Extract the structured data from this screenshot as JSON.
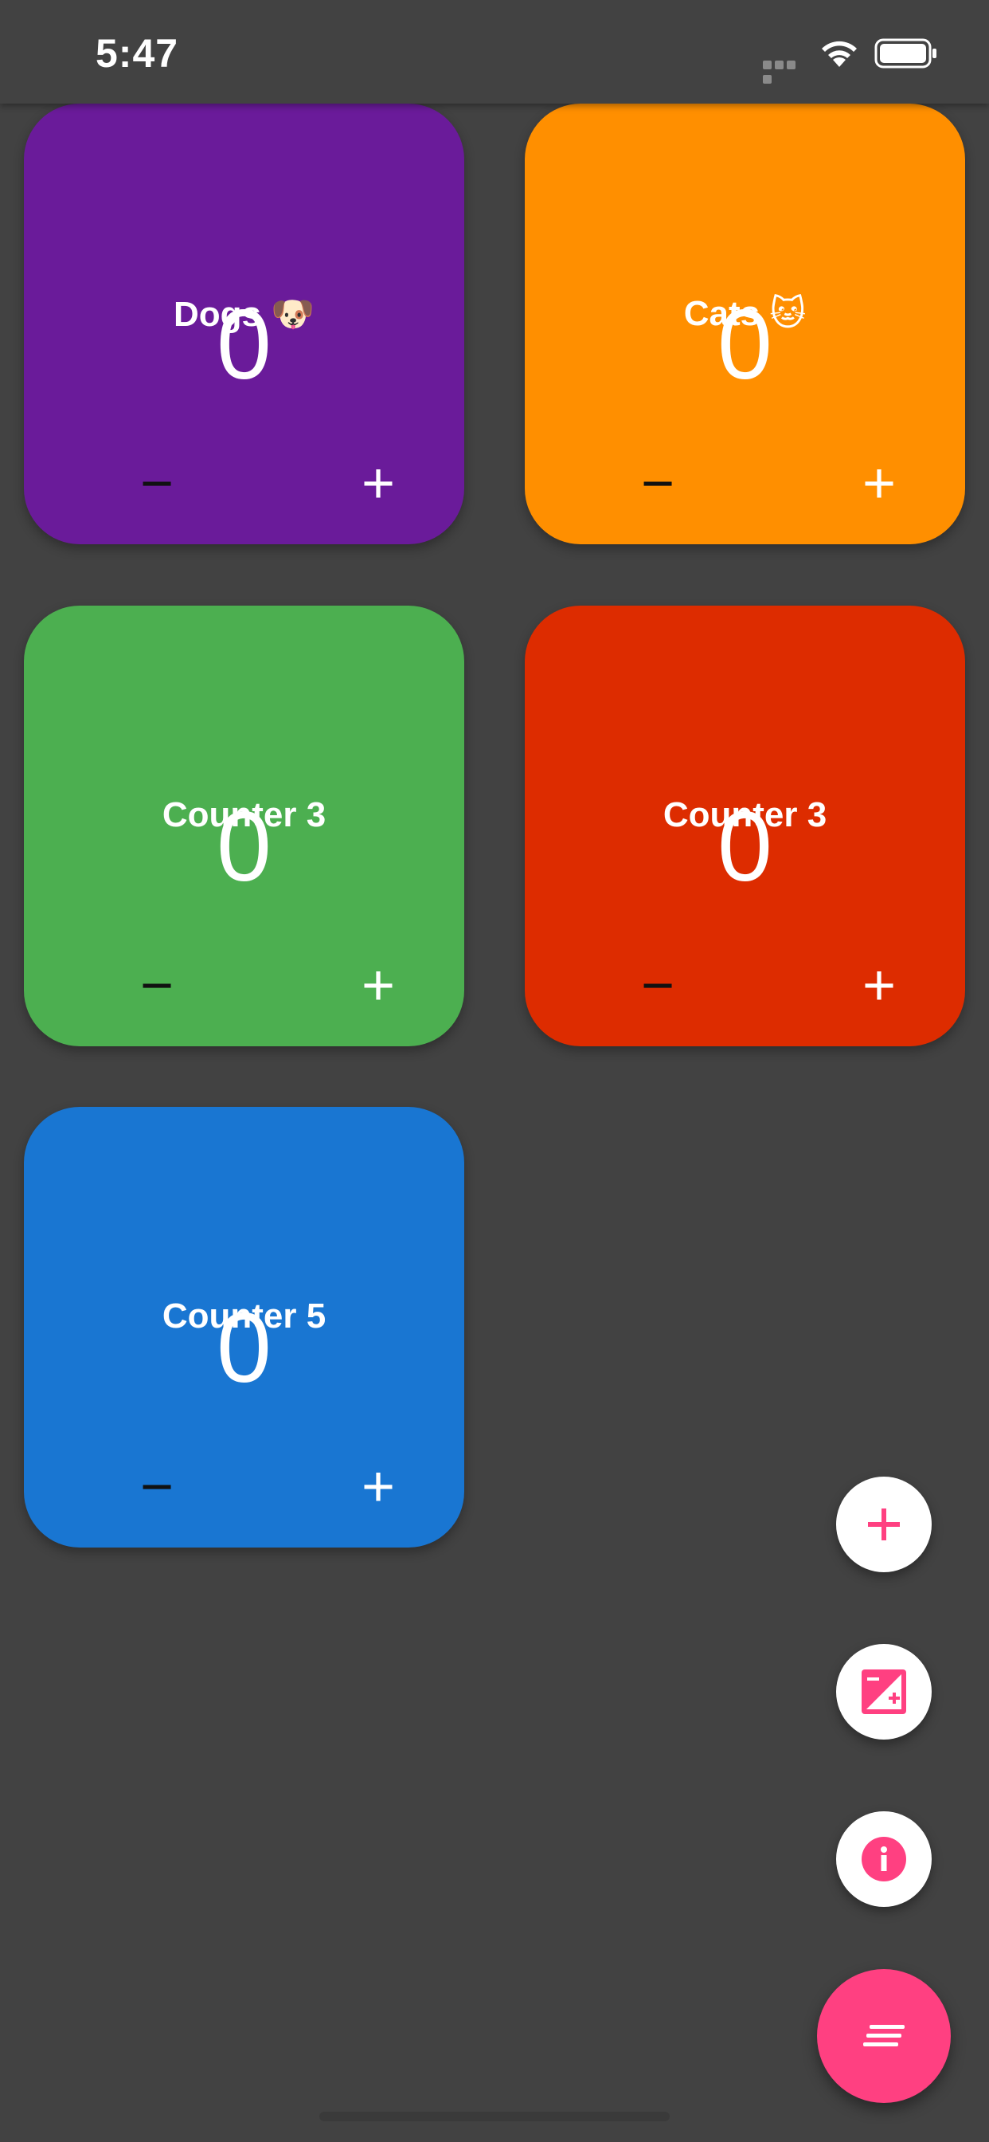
{
  "status_bar": {
    "time": "5:47"
  },
  "counters": [
    {
      "title": "Dogs 🐶",
      "value": "0",
      "color": "#6a1b9a",
      "minus_label": "−",
      "plus_label": "+"
    },
    {
      "title": "Cats 🐱",
      "value": "0",
      "color": "#ff8f00",
      "minus_label": "−",
      "plus_label": "+"
    },
    {
      "title": "Counter 3",
      "value": "0",
      "color": "#4caf50",
      "minus_label": "−",
      "plus_label": "+"
    },
    {
      "title": "Counter 3",
      "value": "0",
      "color": "#dd2c00",
      "minus_label": "−",
      "plus_label": "+"
    },
    {
      "title": "Counter 5",
      "value": "0",
      "color": "#1976d2",
      "minus_label": "−",
      "plus_label": "+"
    }
  ],
  "fab_menu": {
    "accent_color": "#ff4081",
    "items": [
      {
        "icon": "add-icon"
      },
      {
        "icon": "exposure-icon"
      },
      {
        "icon": "info-icon"
      }
    ],
    "main_icon": "menu-lines-icon"
  }
}
